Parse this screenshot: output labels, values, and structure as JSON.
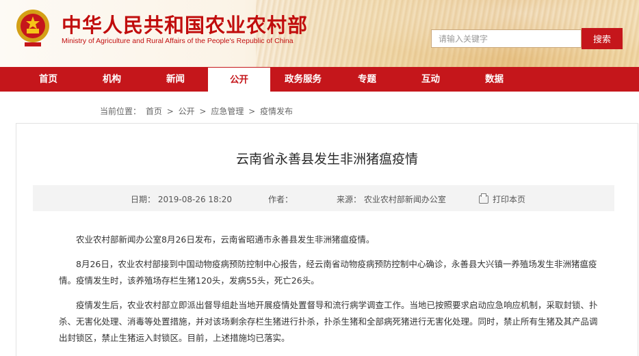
{
  "header": {
    "title_cn": "中华人民共和国农业农村部",
    "title_en": "Ministry of Agriculture and Rural Affairs of the People's Republic of China",
    "search_placeholder": "请输入关键字",
    "search_button": "搜索",
    "emblem_icon": "national-emblem-icon"
  },
  "nav": {
    "items": [
      {
        "label": "首页"
      },
      {
        "label": "机构"
      },
      {
        "label": "新闻"
      },
      {
        "label": "公开",
        "active": true
      },
      {
        "label": "政务服务"
      },
      {
        "label": "专题"
      },
      {
        "label": "互动"
      },
      {
        "label": "数据"
      }
    ]
  },
  "breadcrumb": {
    "prefix": "当前位置：",
    "items": [
      "首页",
      "公开",
      "应急管理",
      "疫情发布"
    ],
    "separator": ">"
  },
  "article": {
    "title": "云南省永善县发生非洲猪瘟疫情",
    "date_label": "日期：",
    "date": "2019-08-26 18:20",
    "author_label": "作者：",
    "author": "",
    "source_label": "来源：",
    "source": "农业农村部新闻办公室",
    "print_label": "打印本页",
    "paragraphs": [
      "农业农村部新闻办公室8月26日发布，云南省昭通市永善县发生非洲猪瘟疫情。",
      "8月26日，农业农村部接到中国动物疫病预防控制中心报告，经云南省动物疫病预防控制中心确诊，永善县大兴镇一养殖场发生非洲猪瘟疫情。疫情发生时，该养殖场存栏生猪120头，发病55头，死亡26头。",
      "疫情发生后，农业农村部立即派出督导组赴当地开展疫情处置督导和流行病学调查工作。当地已按照要求启动应急响应机制，采取封锁、扑杀、无害化处理、消毒等处置措施，并对该场剩余存栏生猪进行扑杀，扑杀生猪和全部病死猪进行无害化处理。同时，禁止所有生猪及其产品调出封锁区，禁止生猪运入封锁区。目前，上述措施均已落实。"
    ]
  },
  "colors": {
    "brand_red": "#c5161b",
    "title_red": "#c10d0d"
  }
}
